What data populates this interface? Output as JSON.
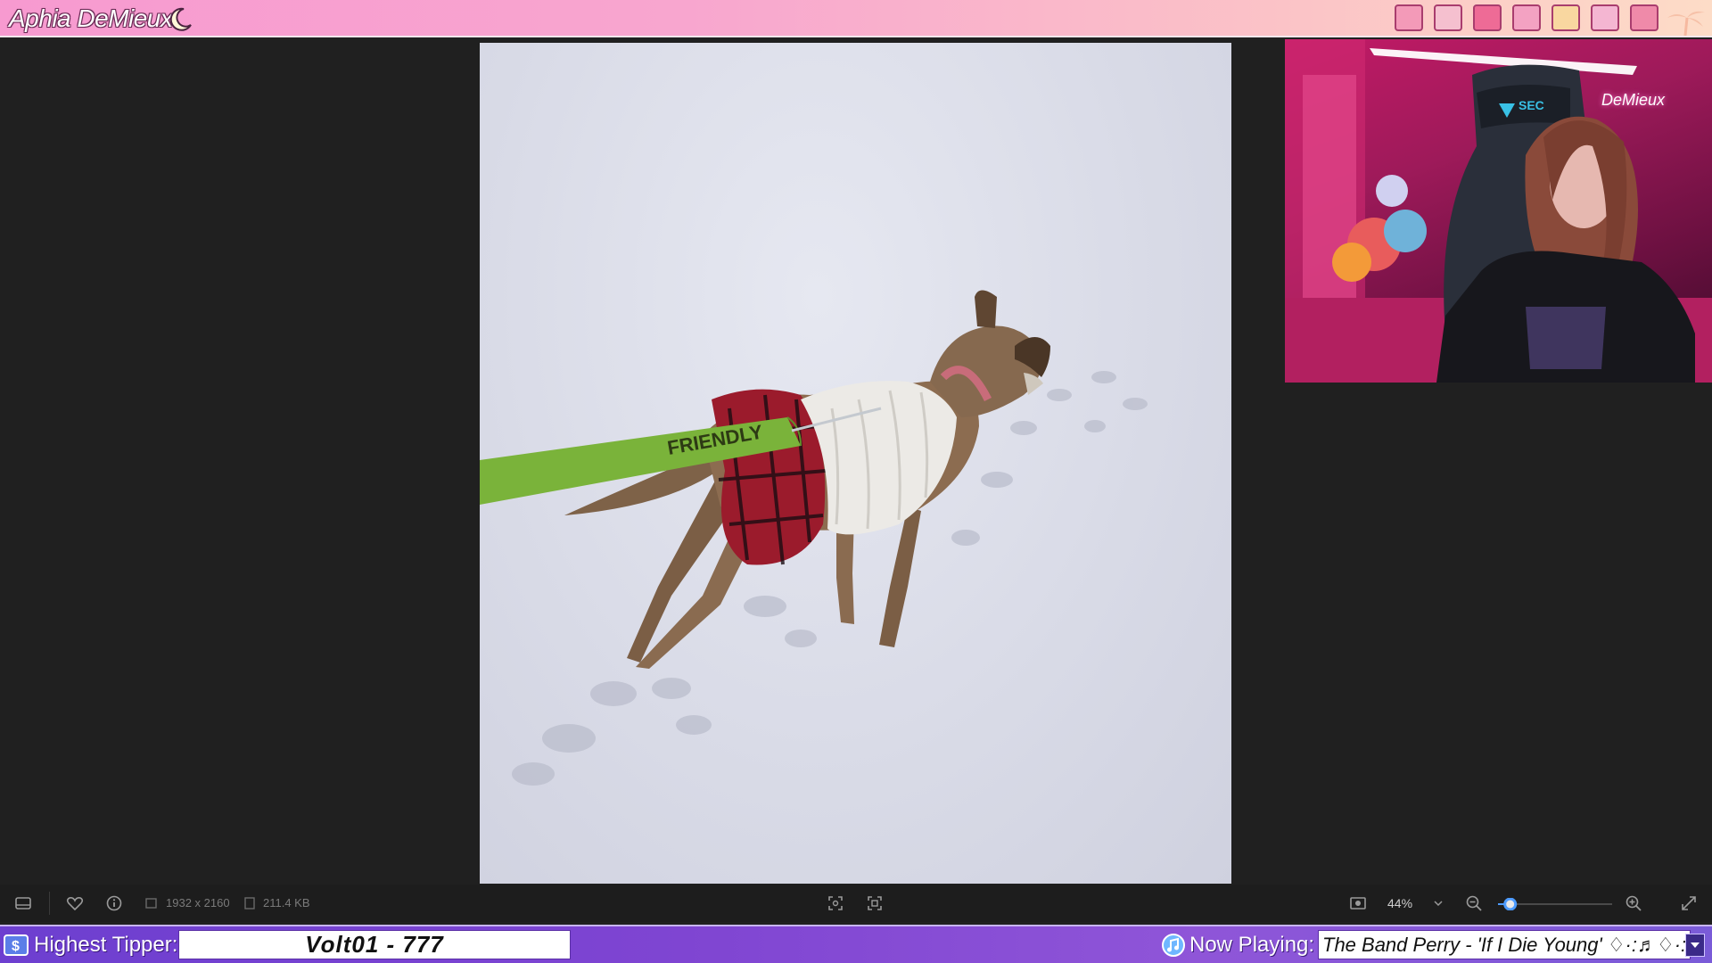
{
  "overlay_top": {
    "streamer_name": "Aphia DeMieux",
    "icons": [
      "eraser-icon",
      "notepad-icon",
      "book-icon",
      "gem-icon",
      "chart-icon",
      "open-book-icon",
      "keyboard-icon"
    ]
  },
  "viewer": {
    "image_dimensions": "1932 x 2160",
    "file_size": "211.4 KB",
    "zoom": "44%",
    "zoom_level_fraction": 0.06,
    "leash_text": "FRIENDLY"
  },
  "webcam": {
    "sign_text": "DeMieux",
    "chair_brand": "SEC"
  },
  "overlay_bottom": {
    "tipper_label": "Highest Tipper:",
    "tipper_value": "Volt01 - 777",
    "now_playing_label": "Now Playing:",
    "now_playing_value": "The Band Perry - 'If I Die Young' ♢·:♬♢·: The"
  },
  "colors": {
    "top_bar_pink": "#f79ad0",
    "bottom_bar_purple": "#7f45d2",
    "viewer_bg": "#202020",
    "leash_green": "#7ab33a"
  }
}
